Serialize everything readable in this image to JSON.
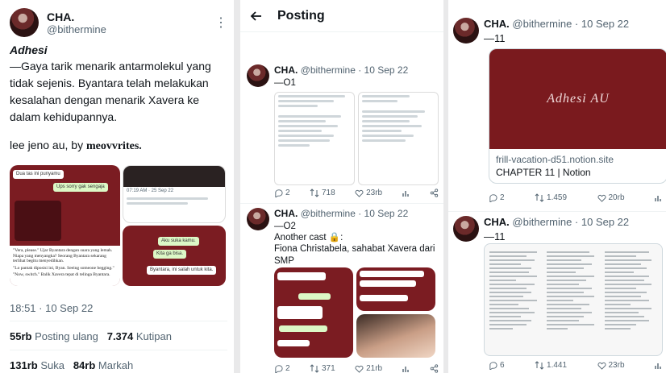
{
  "panel1": {
    "name": "CHA.",
    "handle": "@bithermine",
    "title": "Adhesi",
    "body": "—Gaya tarik menarik antarmolekul yang tidak sejenis. Byantara telah melakukan kesalahan dengan menarik Xavera ke dalam kehidupannya.",
    "credit_prefix": "lee jeno au, by ",
    "credit_author": "meovvrites.",
    "timestamp": "18:51 · 10 Sep 22",
    "reposts_count": "55rb",
    "reposts_label": "Posting ulang",
    "quotes_count": "7.374",
    "quotes_label": "Kutipan",
    "likes_count": "131rb",
    "likes_label": "Suka",
    "bookmarks_count": "84rb",
    "bookmarks_label": "Markah",
    "media": {
      "chat_top_left": "Dua tas ini punyamu",
      "chat_top_right": "Ups sorry gak sengaja",
      "story_caption": "\"Vera, please.\" Ujar Byantara dengan suara yang lemah. Niapa yang menyangka? Seorang Byantara sekarang terlihat begitu menyedihkan.",
      "story_caption2": "\"Lo pantak diposisi ini, Byan. Seeing someone begging.\"",
      "story_caption3": "\"Now, switch.\" Balik Xavera tepat di telinga Byantara.",
      "chat_r1": "Aku suka kamu.",
      "chat_r2": "Kita ga bisa.",
      "chat_r3": "Byantara, ini salah untuk kita.",
      "tweet_preview_time": "07:19 AM · 25 Sep 22"
    }
  },
  "panel2": {
    "nav_title": "Posting",
    "tweet1": {
      "name": "CHA.",
      "handle": "@bithermine · 10 Sep 22",
      "text": "—O1",
      "replies": "2",
      "reposts": "718",
      "likes": "23rb"
    },
    "tweet2": {
      "name": "CHA.",
      "handle": "@bithermine · 10 Sep 22",
      "text_line1": "—O2",
      "text_line2": "Another cast 🔒:",
      "text_line3": "Fiona Christabela, sahabat Xavera dari SMP",
      "replies": "2",
      "reposts": "371",
      "likes": "21rb"
    }
  },
  "panel3": {
    "tweet1": {
      "name": "CHA.",
      "handle": "@bithermine · 10 Sep 22",
      "text": "—11",
      "card_image_text": "Adhesi AU",
      "card_domain": "frill-vacation-d51.notion.site",
      "card_title": "CHAPTER 11 | Notion",
      "replies": "2",
      "reposts": "1.459",
      "likes": "20rb"
    },
    "tweet2": {
      "name": "CHA.",
      "handle": "@bithermine · 10 Sep 22",
      "text": "—11",
      "replies": "6",
      "reposts": "1.441",
      "likes": "23rb"
    }
  },
  "colors": {
    "brand": "#7b1c22",
    "bubble_green": "#dcf8c6",
    "muted": "#536471"
  },
  "icons": [
    "more-icon",
    "back-arrow-icon",
    "reply-icon",
    "repost-icon",
    "like-icon",
    "views-icon",
    "share-icon",
    "lock-icon"
  ]
}
